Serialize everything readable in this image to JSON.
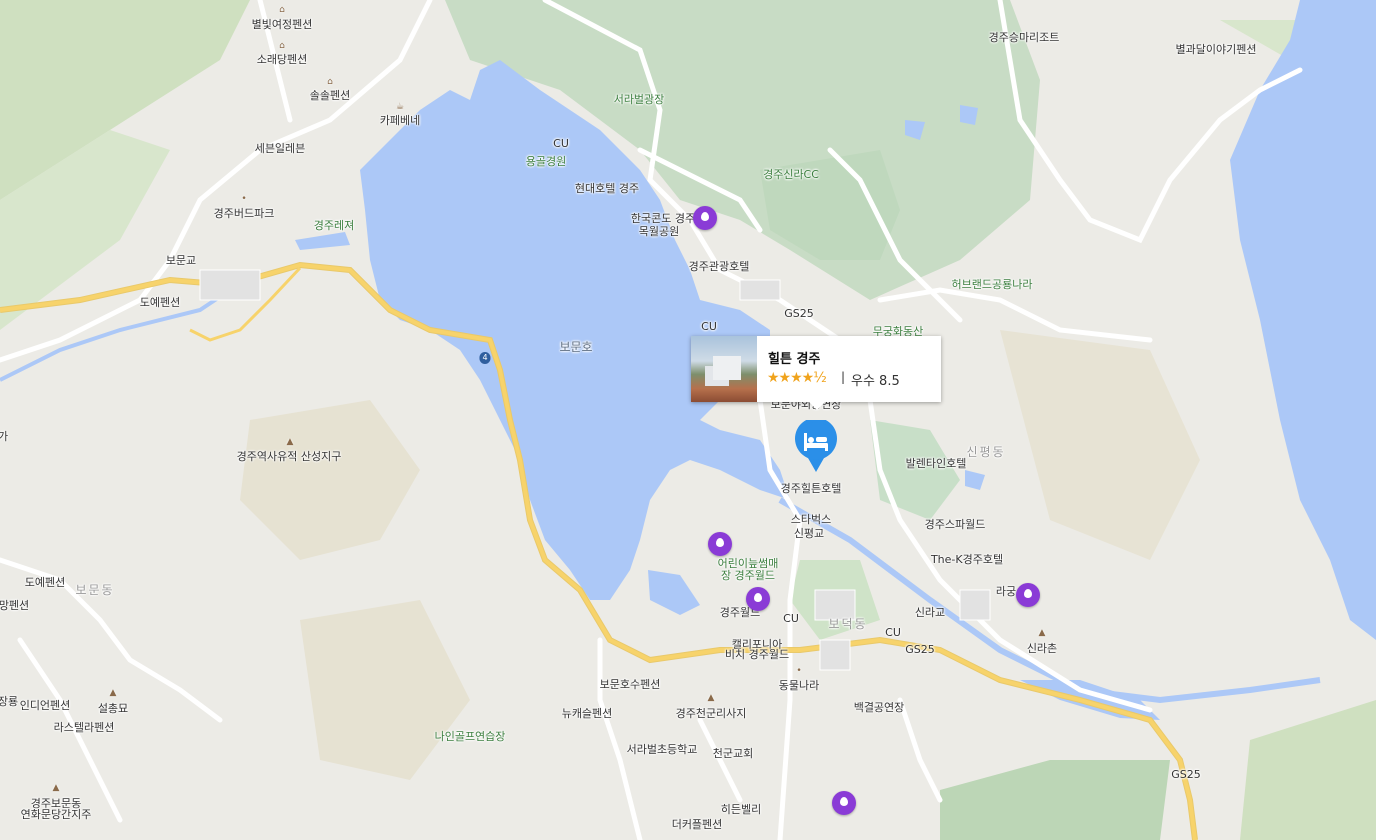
{
  "colors": {
    "water": "#acc8f7",
    "park": "#c8dfc8",
    "road_major": "#f7d36b",
    "road_minor": "#ffffff",
    "pin": "#8a3bd6",
    "hotel_pin": "#2b8fe8",
    "star": "#f0a31c"
  },
  "hotel_card": {
    "name": "힐튼 경주",
    "stars": "★★★★½",
    "star_rating": 4.5,
    "separator": "|",
    "rating_text": "우수 8.5"
  },
  "labels": {
    "byeolbit": "별빛여정펜션",
    "sorae": "소래당펜션",
    "solsol": "솔솔펜션",
    "cafe_bene": "카페베네",
    "seven_eleven": "세븐일레븐",
    "bird_park": "경주버드파크",
    "leisure": "경주레져",
    "bomungyo": "보문교",
    "doye1": "도예펜션",
    "road_4": "4",
    "seorabeol": "서라벌광장",
    "cu1": "CU",
    "yonggol": "용골경원",
    "hyundai": "현대호텔 경주",
    "hanwha": "한국콘도 경주",
    "mokwol": "목월공원",
    "silla_cc": "경주신라CC",
    "gyeongju_tour": "경주관광호텔",
    "gs25_1": "GS25",
    "cu2": "CU",
    "herb_land": "허브랜드공룡나라",
    "mugunghwa": "무궁화동산",
    "bomun_lake": "보문호",
    "bomun_outdoor": "보문야외공연장",
    "hilton_label": "경주힐튼호텔",
    "sinpyeong_dong": "신평동",
    "valentine": "발렌타인호텔",
    "starbucks": "스타벅스",
    "sinpyeonggyo": "신평교",
    "spa": "경주스파월드",
    "the_k": "The-K경주호텔",
    "children": "어린이늪썸매",
    "children2": "장 경주월드",
    "world": "경주월드",
    "cu3": "CU",
    "bodeok": "보덕동",
    "cu4": "CU",
    "sillagyo": "신라교",
    "gs25_2": "GS25",
    "ragung": "라궁",
    "sillachon": "신라촌",
    "california": "캘리포니아",
    "california2": "비치 경주월드",
    "animal": "동물나라",
    "baekgyeol": "백결공연장",
    "sanseong": "경주역사유적 산성지구",
    "doye2": "도예펜션",
    "bomun_dong": "보문동",
    "mang": "망펜션",
    "bomunho_pension": "보문호수펜션",
    "newcastle": "뉴캐슬펜션",
    "cheongun": "경주천군리사지",
    "seorabeol_school": "서라벌초등학교",
    "church": "천군교회",
    "nine_golf": "나인골프연습장",
    "hidden": "히든벨리",
    "double": "더커플펜션",
    "seolchong": "설총묘",
    "indian": "인디언펜션",
    "lastella": "라스텔라펜션",
    "bomundong_tomb": "경주보문동",
    "bomundong_tomb2": "연화문당간지주",
    "jang": "장룡",
    "gyeongju_sungma": "경주승마리조트",
    "byeolgwa": "별과달이야기펜션",
    "gs25_3": "GS25",
    "ga": "가"
  },
  "icons": {
    "hotel_pin": "bed-icon",
    "poi_pin": "map-pin-icon"
  }
}
